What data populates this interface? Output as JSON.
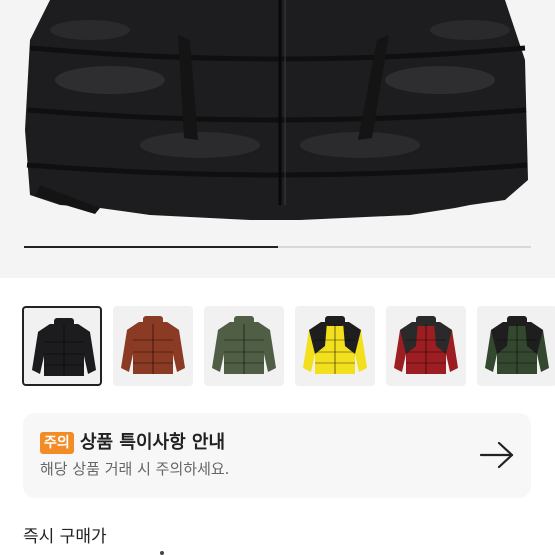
{
  "product_images": {
    "current_index": 1,
    "total": 2,
    "progress_fraction": 0.5
  },
  "thumbnails": [
    {
      "color_name": "black",
      "body_color": "#1c1c1e",
      "accent_color": "#1c1c1e",
      "selected": true
    },
    {
      "color_name": "brown",
      "body_color": "#8b3a24",
      "accent_color": "#8b3a24",
      "selected": false
    },
    {
      "color_name": "olive",
      "body_color": "#4f5e45",
      "accent_color": "#4f5e45",
      "selected": false
    },
    {
      "color_name": "yellow",
      "body_color": "#f2df1e",
      "accent_color": "#1e1e1e",
      "selected": false
    },
    {
      "color_name": "red",
      "body_color": "#9c1e22",
      "accent_color": "#2a2a2a",
      "selected": false
    },
    {
      "color_name": "green",
      "body_color": "#34472f",
      "accent_color": "#1e1e1e",
      "selected": false
    }
  ],
  "notice": {
    "badge": "주의",
    "title": "상품 특이사항 안내",
    "subtitle": "해당 상품 거래 시 주의하세요.",
    "badge_color": "#f28c26",
    "arrow_icon": "arrow-right-icon"
  },
  "purchase": {
    "label": "즉시 구매가"
  }
}
